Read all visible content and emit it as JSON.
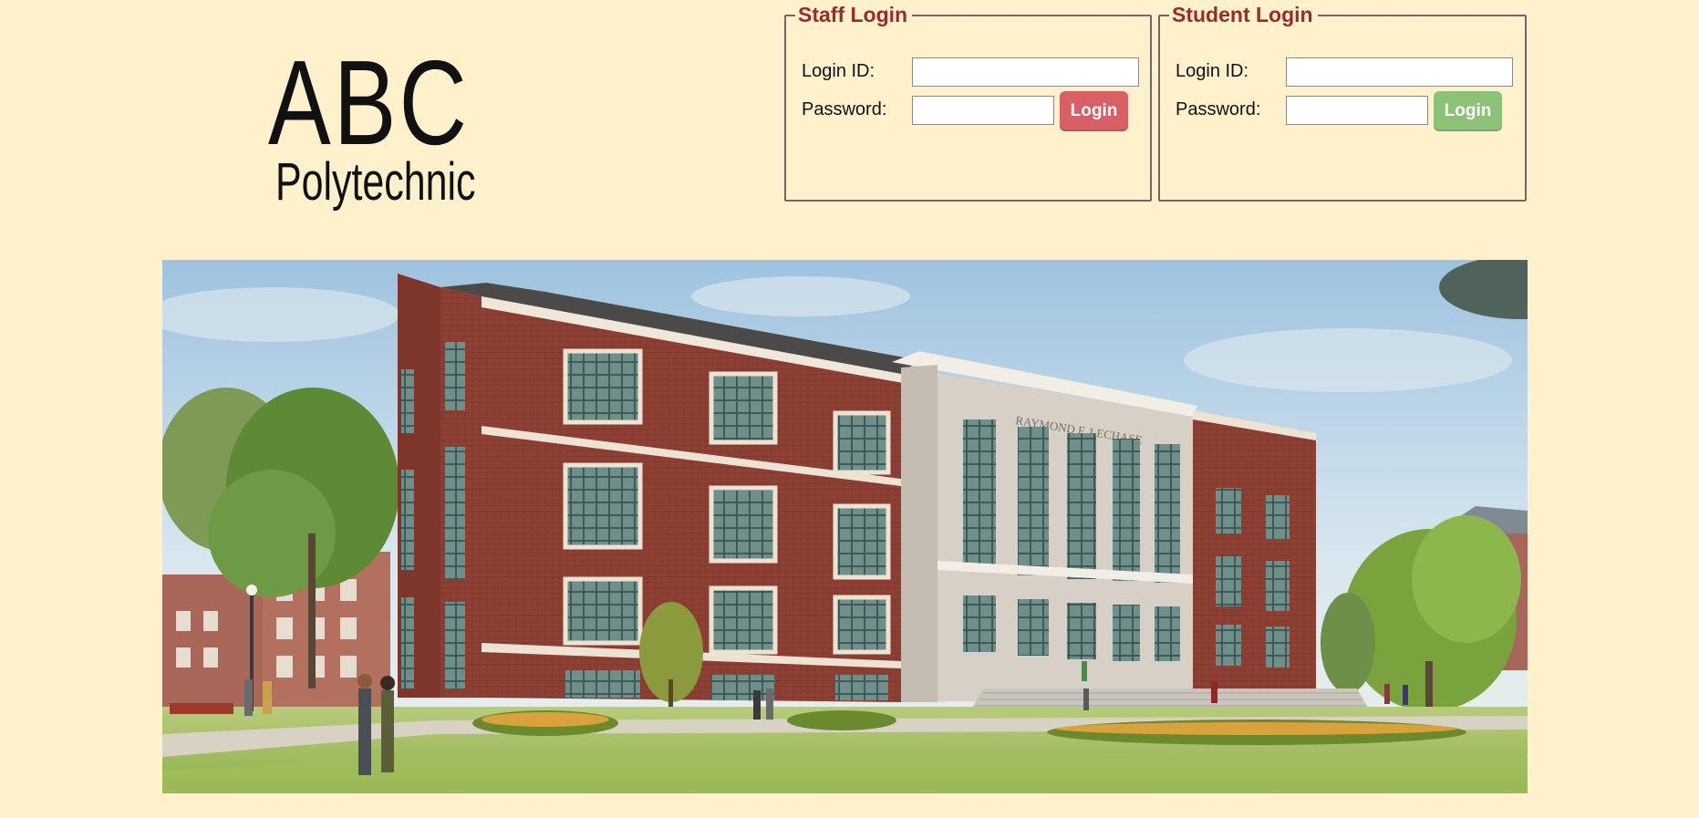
{
  "logo": {
    "main": "ABC",
    "sub": "Polytechnic"
  },
  "staff_login": {
    "legend": "Staff Login",
    "login_id_label": "Login ID:",
    "password_label": "Password:",
    "login_id_value": "",
    "password_value": "",
    "button_label": "Login",
    "button_color": "#d95f66"
  },
  "student_login": {
    "legend": "Student Login",
    "login_id_label": "Login ID:",
    "password_label": "Password:",
    "login_id_value": "",
    "password_value": "",
    "button_label": "Login",
    "button_color": "#8cc178"
  },
  "hero": {
    "building_inscription": "RAYMOND F. LECHASE"
  },
  "colors": {
    "page_background": "#fef1cc",
    "legend_text": "#9c2a2a",
    "fieldset_border": "#6a6a6a"
  }
}
